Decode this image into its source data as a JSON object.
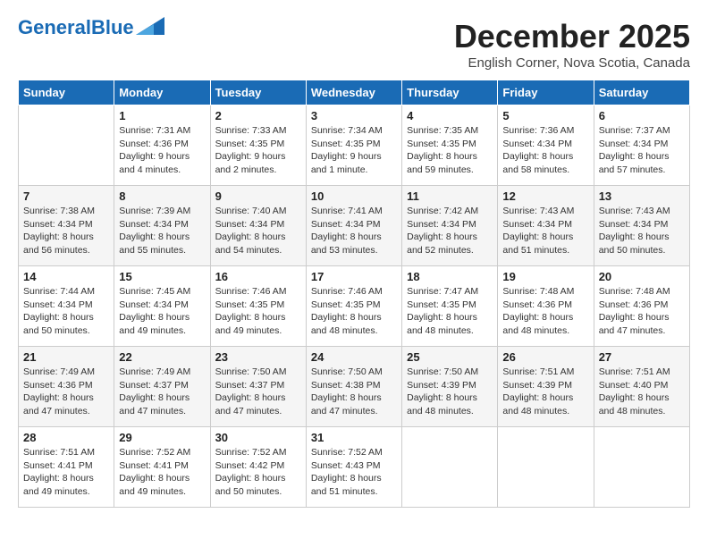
{
  "header": {
    "logo_general": "General",
    "logo_blue": "Blue",
    "month": "December 2025",
    "location": "English Corner, Nova Scotia, Canada"
  },
  "days_of_week": [
    "Sunday",
    "Monday",
    "Tuesday",
    "Wednesday",
    "Thursday",
    "Friday",
    "Saturday"
  ],
  "weeks": [
    [
      {
        "day": "",
        "sunrise": "",
        "sunset": "",
        "daylight": ""
      },
      {
        "day": "1",
        "sunrise": "Sunrise: 7:31 AM",
        "sunset": "Sunset: 4:36 PM",
        "daylight": "Daylight: 9 hours and 4 minutes."
      },
      {
        "day": "2",
        "sunrise": "Sunrise: 7:33 AM",
        "sunset": "Sunset: 4:35 PM",
        "daylight": "Daylight: 9 hours and 2 minutes."
      },
      {
        "day": "3",
        "sunrise": "Sunrise: 7:34 AM",
        "sunset": "Sunset: 4:35 PM",
        "daylight": "Daylight: 9 hours and 1 minute."
      },
      {
        "day": "4",
        "sunrise": "Sunrise: 7:35 AM",
        "sunset": "Sunset: 4:35 PM",
        "daylight": "Daylight: 8 hours and 59 minutes."
      },
      {
        "day": "5",
        "sunrise": "Sunrise: 7:36 AM",
        "sunset": "Sunset: 4:34 PM",
        "daylight": "Daylight: 8 hours and 58 minutes."
      },
      {
        "day": "6",
        "sunrise": "Sunrise: 7:37 AM",
        "sunset": "Sunset: 4:34 PM",
        "daylight": "Daylight: 8 hours and 57 minutes."
      }
    ],
    [
      {
        "day": "7",
        "sunrise": "Sunrise: 7:38 AM",
        "sunset": "Sunset: 4:34 PM",
        "daylight": "Daylight: 8 hours and 56 minutes."
      },
      {
        "day": "8",
        "sunrise": "Sunrise: 7:39 AM",
        "sunset": "Sunset: 4:34 PM",
        "daylight": "Daylight: 8 hours and 55 minutes."
      },
      {
        "day": "9",
        "sunrise": "Sunrise: 7:40 AM",
        "sunset": "Sunset: 4:34 PM",
        "daylight": "Daylight: 8 hours and 54 minutes."
      },
      {
        "day": "10",
        "sunrise": "Sunrise: 7:41 AM",
        "sunset": "Sunset: 4:34 PM",
        "daylight": "Daylight: 8 hours and 53 minutes."
      },
      {
        "day": "11",
        "sunrise": "Sunrise: 7:42 AM",
        "sunset": "Sunset: 4:34 PM",
        "daylight": "Daylight: 8 hours and 52 minutes."
      },
      {
        "day": "12",
        "sunrise": "Sunrise: 7:43 AM",
        "sunset": "Sunset: 4:34 PM",
        "daylight": "Daylight: 8 hours and 51 minutes."
      },
      {
        "day": "13",
        "sunrise": "Sunrise: 7:43 AM",
        "sunset": "Sunset: 4:34 PM",
        "daylight": "Daylight: 8 hours and 50 minutes."
      }
    ],
    [
      {
        "day": "14",
        "sunrise": "Sunrise: 7:44 AM",
        "sunset": "Sunset: 4:34 PM",
        "daylight": "Daylight: 8 hours and 50 minutes."
      },
      {
        "day": "15",
        "sunrise": "Sunrise: 7:45 AM",
        "sunset": "Sunset: 4:34 PM",
        "daylight": "Daylight: 8 hours and 49 minutes."
      },
      {
        "day": "16",
        "sunrise": "Sunrise: 7:46 AM",
        "sunset": "Sunset: 4:35 PM",
        "daylight": "Daylight: 8 hours and 49 minutes."
      },
      {
        "day": "17",
        "sunrise": "Sunrise: 7:46 AM",
        "sunset": "Sunset: 4:35 PM",
        "daylight": "Daylight: 8 hours and 48 minutes."
      },
      {
        "day": "18",
        "sunrise": "Sunrise: 7:47 AM",
        "sunset": "Sunset: 4:35 PM",
        "daylight": "Daylight: 8 hours and 48 minutes."
      },
      {
        "day": "19",
        "sunrise": "Sunrise: 7:48 AM",
        "sunset": "Sunset: 4:36 PM",
        "daylight": "Daylight: 8 hours and 48 minutes."
      },
      {
        "day": "20",
        "sunrise": "Sunrise: 7:48 AM",
        "sunset": "Sunset: 4:36 PM",
        "daylight": "Daylight: 8 hours and 47 minutes."
      }
    ],
    [
      {
        "day": "21",
        "sunrise": "Sunrise: 7:49 AM",
        "sunset": "Sunset: 4:36 PM",
        "daylight": "Daylight: 8 hours and 47 minutes."
      },
      {
        "day": "22",
        "sunrise": "Sunrise: 7:49 AM",
        "sunset": "Sunset: 4:37 PM",
        "daylight": "Daylight: 8 hours and 47 minutes."
      },
      {
        "day": "23",
        "sunrise": "Sunrise: 7:50 AM",
        "sunset": "Sunset: 4:37 PM",
        "daylight": "Daylight: 8 hours and 47 minutes."
      },
      {
        "day": "24",
        "sunrise": "Sunrise: 7:50 AM",
        "sunset": "Sunset: 4:38 PM",
        "daylight": "Daylight: 8 hours and 47 minutes."
      },
      {
        "day": "25",
        "sunrise": "Sunrise: 7:50 AM",
        "sunset": "Sunset: 4:39 PM",
        "daylight": "Daylight: 8 hours and 48 minutes."
      },
      {
        "day": "26",
        "sunrise": "Sunrise: 7:51 AM",
        "sunset": "Sunset: 4:39 PM",
        "daylight": "Daylight: 8 hours and 48 minutes."
      },
      {
        "day": "27",
        "sunrise": "Sunrise: 7:51 AM",
        "sunset": "Sunset: 4:40 PM",
        "daylight": "Daylight: 8 hours and 48 minutes."
      }
    ],
    [
      {
        "day": "28",
        "sunrise": "Sunrise: 7:51 AM",
        "sunset": "Sunset: 4:41 PM",
        "daylight": "Daylight: 8 hours and 49 minutes."
      },
      {
        "day": "29",
        "sunrise": "Sunrise: 7:52 AM",
        "sunset": "Sunset: 4:41 PM",
        "daylight": "Daylight: 8 hours and 49 minutes."
      },
      {
        "day": "30",
        "sunrise": "Sunrise: 7:52 AM",
        "sunset": "Sunset: 4:42 PM",
        "daylight": "Daylight: 8 hours and 50 minutes."
      },
      {
        "day": "31",
        "sunrise": "Sunrise: 7:52 AM",
        "sunset": "Sunset: 4:43 PM",
        "daylight": "Daylight: 8 hours and 51 minutes."
      },
      {
        "day": "",
        "sunrise": "",
        "sunset": "",
        "daylight": ""
      },
      {
        "day": "",
        "sunrise": "",
        "sunset": "",
        "daylight": ""
      },
      {
        "day": "",
        "sunrise": "",
        "sunset": "",
        "daylight": ""
      }
    ]
  ]
}
